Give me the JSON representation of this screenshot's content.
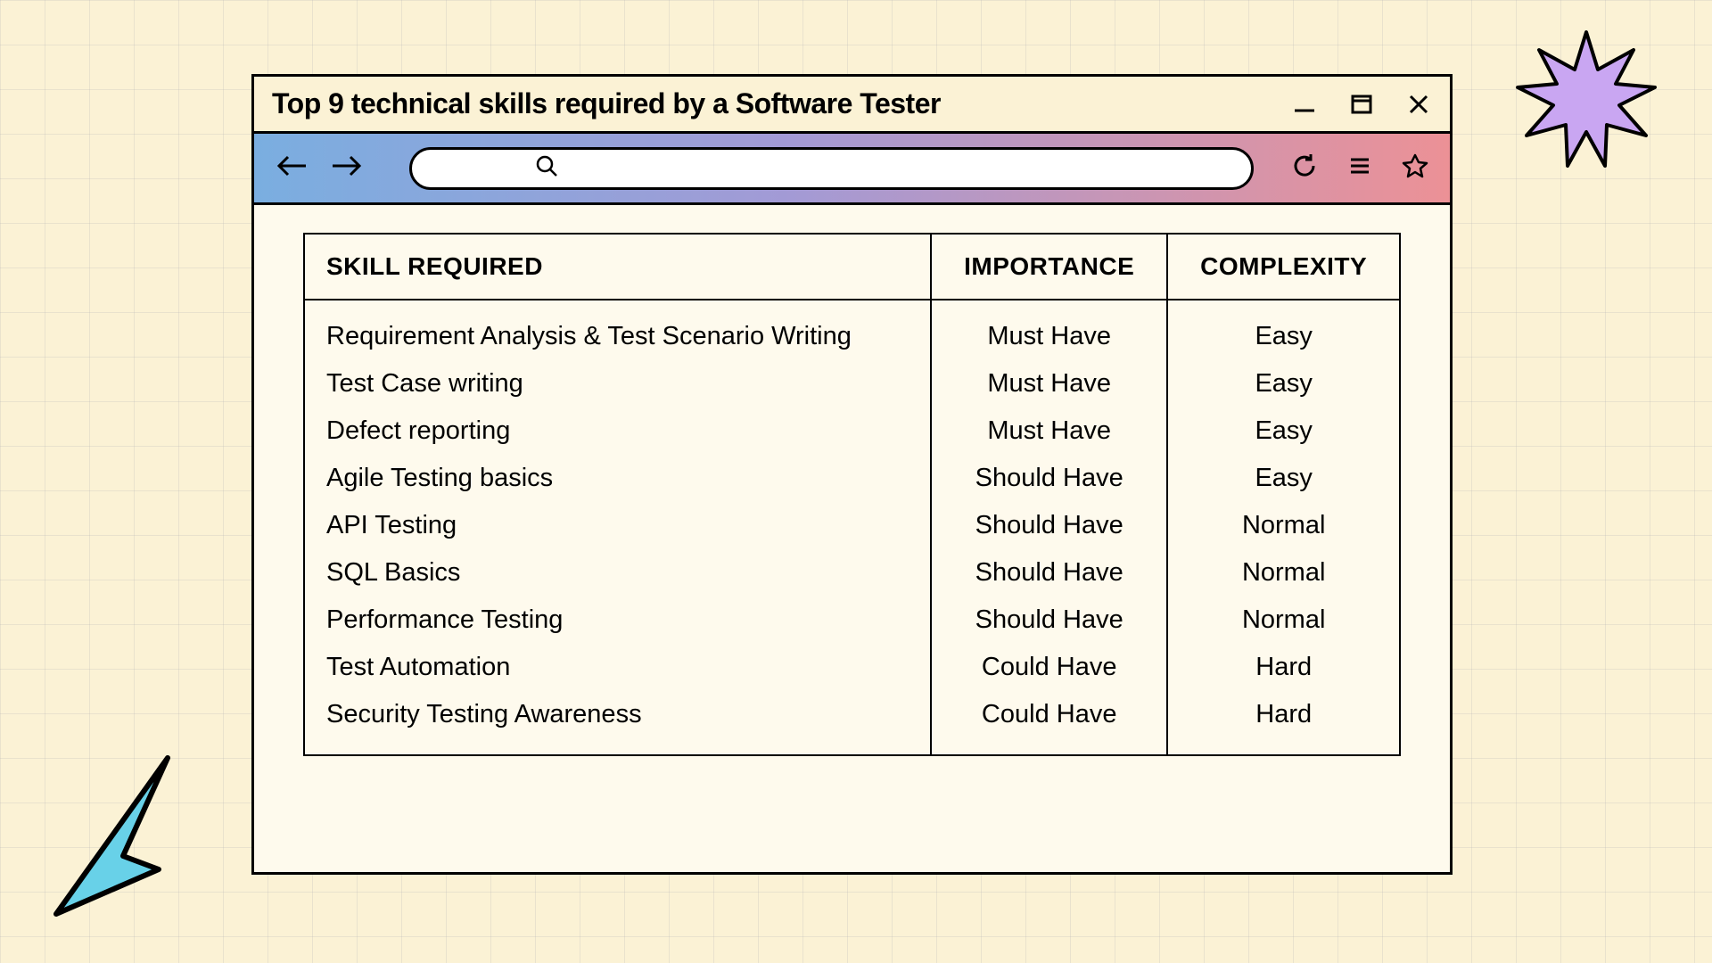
{
  "window": {
    "title": "Top 9 technical skills required by a Software Tester"
  },
  "toolbar": {
    "search_value": ""
  },
  "table": {
    "headers": [
      "SKILL REQUIRED",
      "IMPORTANCE",
      "COMPLEXITY"
    ],
    "rows": [
      {
        "skill": "Requirement Analysis & Test Scenario Writing",
        "importance": "Must Have",
        "complexity": "Easy"
      },
      {
        "skill": "Test Case writing",
        "importance": "Must Have",
        "complexity": "Easy"
      },
      {
        "skill": "Defect reporting",
        "importance": "Must Have",
        "complexity": "Easy"
      },
      {
        "skill": "Agile Testing basics",
        "importance": "Should Have",
        "complexity": "Easy"
      },
      {
        "skill": "API Testing",
        "importance": "Should Have",
        "complexity": "Normal"
      },
      {
        "skill": "SQL Basics",
        "importance": "Should Have",
        "complexity": "Normal"
      },
      {
        "skill": "Performance Testing",
        "importance": "Should Have",
        "complexity": "Normal"
      },
      {
        "skill": "Test Automation",
        "importance": "Could Have",
        "complexity": "Hard"
      },
      {
        "skill": "Security Testing Awareness",
        "importance": "Could Have",
        "complexity": "Hard"
      }
    ]
  },
  "chart_data": {
    "type": "table",
    "title": "Top 9 technical skills required by a Software Tester",
    "columns": [
      "SKILL REQUIRED",
      "IMPORTANCE",
      "COMPLEXITY"
    ],
    "rows": [
      [
        "Requirement Analysis & Test Scenario Writing",
        "Must Have",
        "Easy"
      ],
      [
        "Test Case writing",
        "Must Have",
        "Easy"
      ],
      [
        "Defect reporting",
        "Must Have",
        "Easy"
      ],
      [
        "Agile Testing basics",
        "Should Have",
        "Easy"
      ],
      [
        "API Testing",
        "Should Have",
        "Normal"
      ],
      [
        "SQL Basics",
        "Should Have",
        "Normal"
      ],
      [
        "Performance Testing",
        "Should Have",
        "Normal"
      ],
      [
        "Test Automation",
        "Could Have",
        "Hard"
      ],
      [
        "Security Testing Awareness",
        "Could Have",
        "Hard"
      ]
    ]
  }
}
